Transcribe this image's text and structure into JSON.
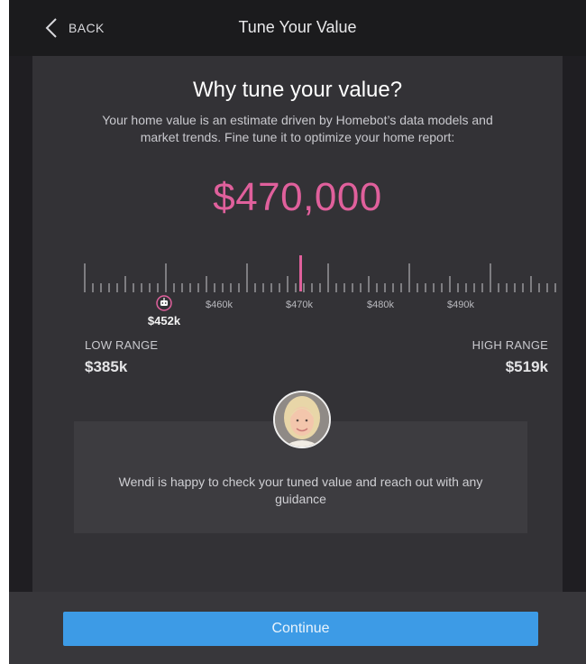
{
  "header": {
    "back_label": "BACK",
    "title": "Tune Your Value"
  },
  "intro": {
    "title": "Why tune your value?",
    "description": "Your home value is an estimate driven by Homebot’s data models and market trends. Fine tune it to optimize your home report:"
  },
  "value": {
    "current": "$470,000",
    "accent_color": "#e0609c"
  },
  "slider": {
    "tick_labels": [
      "$460k",
      "$470k",
      "$480k",
      "$490k"
    ],
    "estimate_icon": "homebot-robot-icon",
    "estimate_label": "$452k",
    "selected_value_k": 470
  },
  "range": {
    "low_label": "LOW RANGE",
    "low_value": "$385k",
    "high_label": "HIGH RANGE",
    "high_value": "$519k"
  },
  "agent": {
    "avatar_icon": "agent-avatar-photo",
    "message": "Wendi is happy to check your tuned value and reach out with any guidance"
  },
  "footer": {
    "continue_label": "Continue",
    "button_color": "#3d9be6"
  }
}
